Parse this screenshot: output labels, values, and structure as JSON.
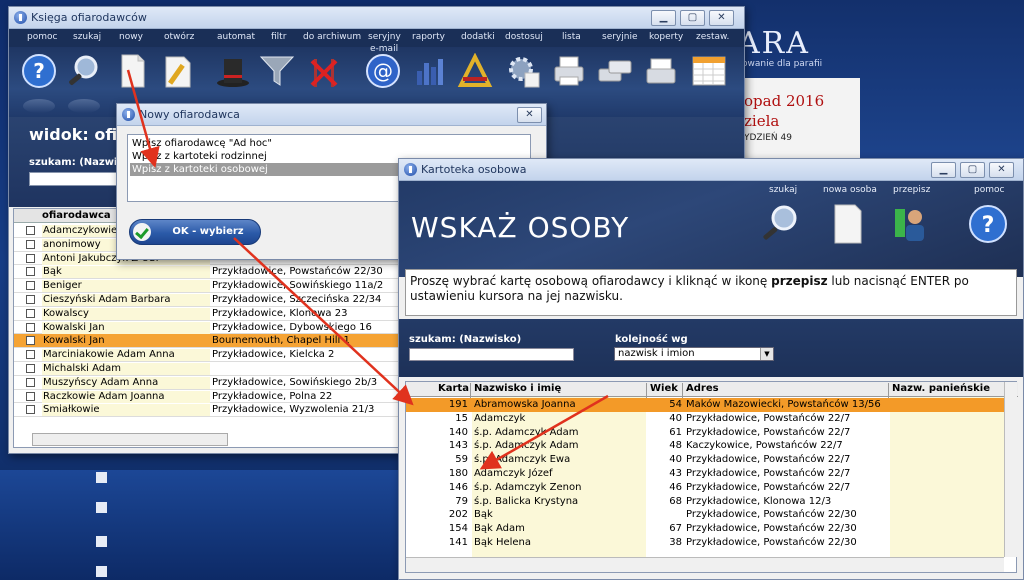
{
  "background": {
    "logo_text": "ARA",
    "logo_sub": "owanie dla parafii",
    "calendar_date": "opad 2016",
    "calendar_day": "ziela",
    "calendar_week": "YDZIEŃ 49"
  },
  "main_window": {
    "title": "Księga ofiarodawców",
    "menu": [
      "pomoc",
      "szukaj",
      "nowy",
      "otwórz",
      "automat",
      "filtr",
      "do archiwum",
      "seryjny",
      "raporty",
      "dodatki",
      "dostosuj",
      "lista",
      "seryjnie",
      "koperty",
      "zestaw."
    ],
    "menu_sub": "e-mail",
    "widok_label": "widok: ofiar",
    "szukaj_label": "szukam: (Nazwis",
    "grid_header": "ofiarodawca",
    "rows": [
      {
        "name": "Adamczykowie",
        "address": ""
      },
      {
        "name": "anonimowy",
        "address": ""
      },
      {
        "name": "Antoni Jakubczyk Z OSP",
        "address": ""
      },
      {
        "name": "Bąk",
        "address": "Przykładowice, Powstańców 22/30"
      },
      {
        "name": "Beniger",
        "address": "Przykładowice, Sowińskiego 11a/2"
      },
      {
        "name": "Cieszyński Adam Barbara",
        "address": "Przykładowice, Szczecińska 22/34"
      },
      {
        "name": "Kowalscy",
        "address": "Przykładowice, Klonowa 23"
      },
      {
        "name": "Kowalski Jan",
        "address": "Przykładowice, Dybowskiego 16"
      },
      {
        "name": "Kowalski Jan",
        "address": "Bournemouth, Chapel Hill 1"
      },
      {
        "name": "Marciniakowie Adam Anna",
        "address": "Przykładowice, Kielcka 2"
      },
      {
        "name": "Michalski Adam",
        "address": ""
      },
      {
        "name": "Muszyńscy Adam Anna",
        "address": "Przykładowice, Sowińskiego 2b/3"
      },
      {
        "name": "Raczkowie Adam Joanna",
        "address": "Przykładowice, Polna 22"
      },
      {
        "name": "Śmiałkowie",
        "address": "Przykładowice, Wyzwolenia 21/3"
      }
    ]
  },
  "new_dialog": {
    "title": "Nowy ofiarodawca",
    "options": [
      "Wpisz ofiarodawcę \"Ad hoc\"",
      "Wpisz z kartoteki rodzinnej",
      "Wpisz z kartoteki osobowej"
    ],
    "ok_label": "OK - wybierz"
  },
  "kartoteka": {
    "title": "Kartoteka osobowa",
    "heading": "WSKAŻ OSOBY",
    "tools": [
      "szukaj",
      "nowa osoba",
      "przepisz",
      "pomoc"
    ],
    "info_part1": "Proszę wybrać kartę osobową ofiarodawcy i kliknąć w ikonę ",
    "info_bold": "przepisz",
    "info_part2": " lub nacisnąć ENTER po ustawieniu kursora na jej nazwisku.",
    "szukaj_label": "szukam: (Nazwisko)",
    "order_label": "kolejność wg",
    "order_value": "nazwisk i imion",
    "columns": [
      "Karta",
      "Nazwisko i imię",
      "Wiek",
      "Adres",
      "Nazw. panieńskie"
    ],
    "rows": [
      {
        "karta": "191",
        "name": "Abramowska Joanna",
        "wiek": "54",
        "adres": "Maków Mazowiecki, Powstańców 13/56"
      },
      {
        "karta": "15",
        "name": "Adamczyk",
        "wiek": "40",
        "adres": "Przykładowice, Powstańców 22/7"
      },
      {
        "karta": "140",
        "name": "ś.p. Adamczyk Adam",
        "wiek": "61",
        "adres": "Przykładowice, Powstańców 22/7"
      },
      {
        "karta": "143",
        "name": "ś.p. Adamczyk Adam",
        "wiek": "48",
        "adres": "Kaczykowice, Powstańców 22/7"
      },
      {
        "karta": "59",
        "name": "ś.p. Adamczyk Ewa",
        "wiek": "40",
        "adres": "Przykładowice, Powstańców 22/7"
      },
      {
        "karta": "180",
        "name": "Adamczyk Józef",
        "wiek": "43",
        "adres": "Przykładowice, Powstańców 22/7"
      },
      {
        "karta": "146",
        "name": "ś.p. Adamczyk Zenon",
        "wiek": "46",
        "adres": "Przykładowice, Powstańców 22/7"
      },
      {
        "karta": "79",
        "name": "ś.p. Balicka Krystyna",
        "wiek": "68",
        "adres": "Przykładowice, Klonowa 12/3"
      },
      {
        "karta": "202",
        "name": "Bąk",
        "wiek": "",
        "adres": "Przykładowice, Powstańców 22/30"
      },
      {
        "karta": "154",
        "name": "Bąk Adam",
        "wiek": "67",
        "adres": "Przykładowice, Powstańców 22/30"
      },
      {
        "karta": "141",
        "name": "Bąk Helena",
        "wiek": "38",
        "adres": "Przykładowice, Powstańców 22/30"
      }
    ]
  },
  "colors": {
    "selection": "#f39a28",
    "arrow": "#e0321e",
    "title_blue": "#20365e"
  }
}
